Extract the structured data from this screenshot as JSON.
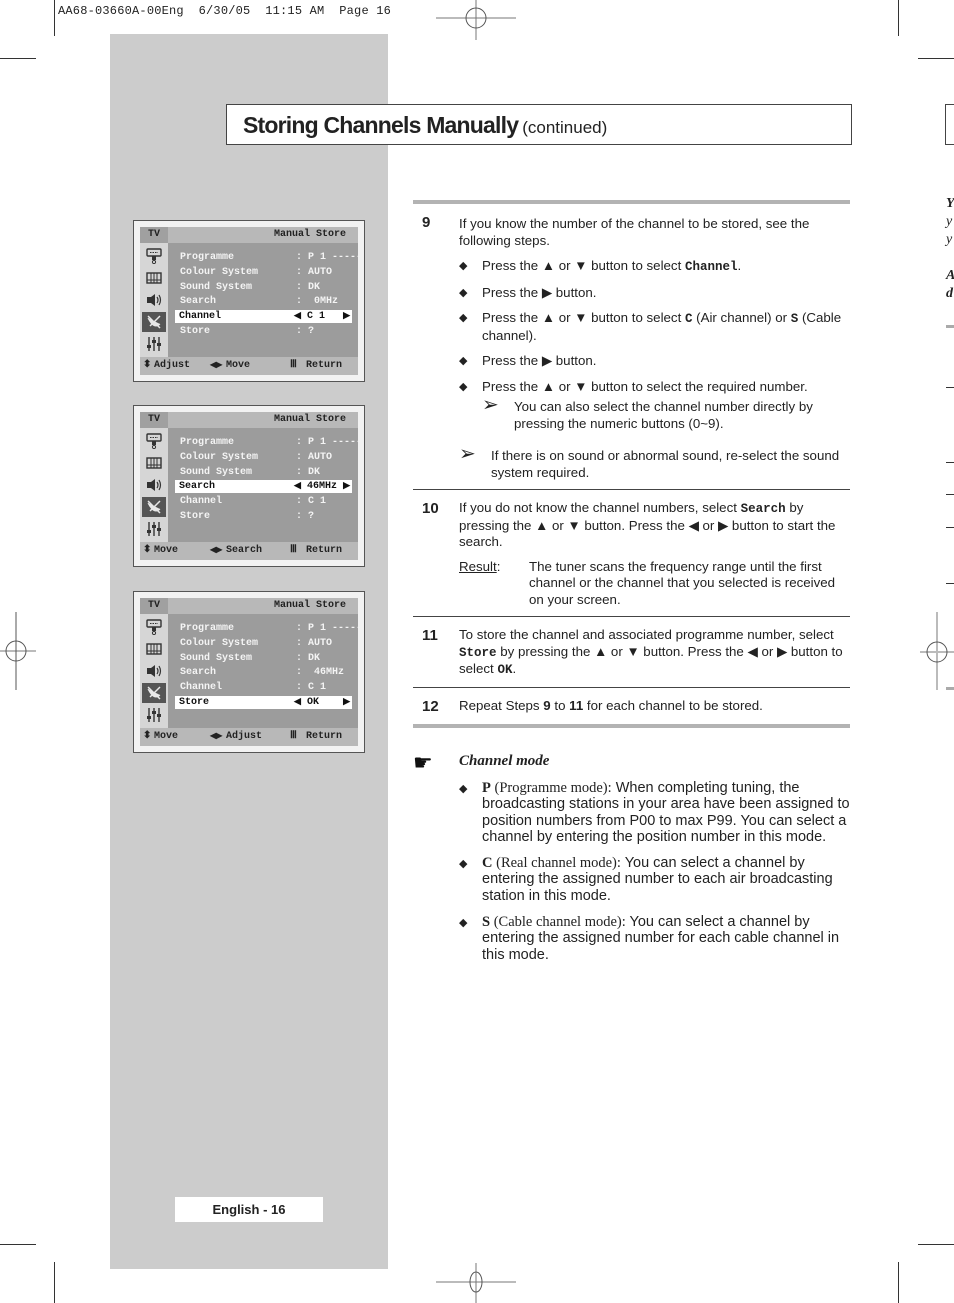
{
  "print_slug": "AA68-03660A-00Eng  6/30/05  11:15 AM  Page 16",
  "header": {
    "title": "Storing Channels Manually",
    "subtitle": "(continued)"
  },
  "osd_screens": [
    {
      "tv_label": "TV",
      "menu_title": "Manual Store",
      "rows": [
        {
          "label": "Programme",
          "value": ": P 1 -----"
        },
        {
          "label": "Colour System",
          "value": ": AUTO"
        },
        {
          "label": "Sound System",
          "value": ": DK"
        },
        {
          "label": "Search",
          "value": ":  0MHz"
        },
        {
          "label": "Channel",
          "value": "C 1",
          "selected": true
        },
        {
          "label": "Store",
          "value": ": ?"
        }
      ],
      "footer": {
        "left": "Adjust",
        "middle": "Move",
        "right": "Return"
      }
    },
    {
      "tv_label": "TV",
      "menu_title": "Manual Store",
      "rows": [
        {
          "label": "Programme",
          "value": ": P 1 -----"
        },
        {
          "label": "Colour System",
          "value": ": AUTO"
        },
        {
          "label": "Sound System",
          "value": ": DK"
        },
        {
          "label": "Search",
          "value": "46MHz",
          "selected": true
        },
        {
          "label": "Channel",
          "value": ": C 1"
        },
        {
          "label": "Store",
          "value": ": ?"
        }
      ],
      "footer": {
        "left": "Move",
        "middle": "Search",
        "right": "Return"
      }
    },
    {
      "tv_label": "TV",
      "menu_title": "Manual Store",
      "rows": [
        {
          "label": "Programme",
          "value": ": P 1 -----"
        },
        {
          "label": "Colour System",
          "value": ": AUTO"
        },
        {
          "label": "Sound System",
          "value": ": DK"
        },
        {
          "label": "Search",
          "value": ":  46MHz"
        },
        {
          "label": "Channel",
          "value": ": C 1"
        },
        {
          "label": "Store",
          "value": "OK",
          "selected": true
        }
      ],
      "footer": {
        "left": "Move",
        "middle": "Adjust",
        "right": "Return"
      }
    }
  ],
  "osd_icons": [
    "input-icon",
    "picture-icon",
    "sound-icon",
    "channel-icon",
    "setup-icon"
  ],
  "steps": [
    {
      "number": "9",
      "intro": "If you know the number of the channel to be stored, see the following steps.",
      "bullets": [
        {
          "pre": "Press the ▲ or ▼ button to select ",
          "code": "Channel",
          "post": "."
        },
        {
          "pre": "Press the ▶ button.",
          "code": "",
          "post": ""
        },
        {
          "pre": "Press the ▲ or ▼ button to select ",
          "code": "C",
          "mid": " (Air channel) or ",
          "code2": "S",
          "post": " (Cable channel)."
        },
        {
          "pre": "Press the ▶ button.",
          "code": "",
          "post": ""
        },
        {
          "pre": "Press the ▲ or ▼ button to select the required number.",
          "code": "",
          "post": ""
        }
      ],
      "sub_note": "You can also select the channel number directly by pressing the numeric buttons (0~9).",
      "note": "If there is on sound or abnormal sound, re-select the sound system required."
    },
    {
      "number": "10",
      "text_pre": "If you do not know the channel numbers, select ",
      "code": "Search",
      "text_post": " by pressing the ▲ or ▼ button. Press the ◀ or ▶ button to start the search.",
      "result_label": "Result",
      "result_text": "The tuner scans the frequency range until the first channel or the channel that you selected is received on your screen."
    },
    {
      "number": "11",
      "text_pre": "To store the channel and associated programme number, select ",
      "code": "Store",
      "text_mid": " by pressing the ▲ or ▼ button. Press the ◀ or ▶ button to select ",
      "code2": "OK",
      "text_post": "."
    },
    {
      "number": "12",
      "text_pre": "Repeat Steps ",
      "b1": "9",
      "text_mid": " to ",
      "b2": "11",
      "text_post": " for each channel to be stored."
    }
  ],
  "channel_mode": {
    "title": "Channel mode",
    "items": [
      {
        "key": "P",
        "desc": " (Programme mode):",
        "text": " When completing tuning, the broadcasting stations in your area have been assigned to position numbers from P00 to max P99. You can select a channel by entering the position number in this mode."
      },
      {
        "key": "C",
        "desc": " (Real channel mode):",
        "text": " You can select a channel by entering the assigned number to each air broadcasting station in this mode."
      },
      {
        "key": "S",
        "desc": " (Cable channel mode):",
        "text": " You can select a channel by entering the assigned number for each cable channel in this mode."
      }
    ]
  },
  "footer": {
    "page_label": "English - 16"
  },
  "edge_fragments": [
    "Y",
    "y",
    "y",
    "A",
    "d"
  ]
}
